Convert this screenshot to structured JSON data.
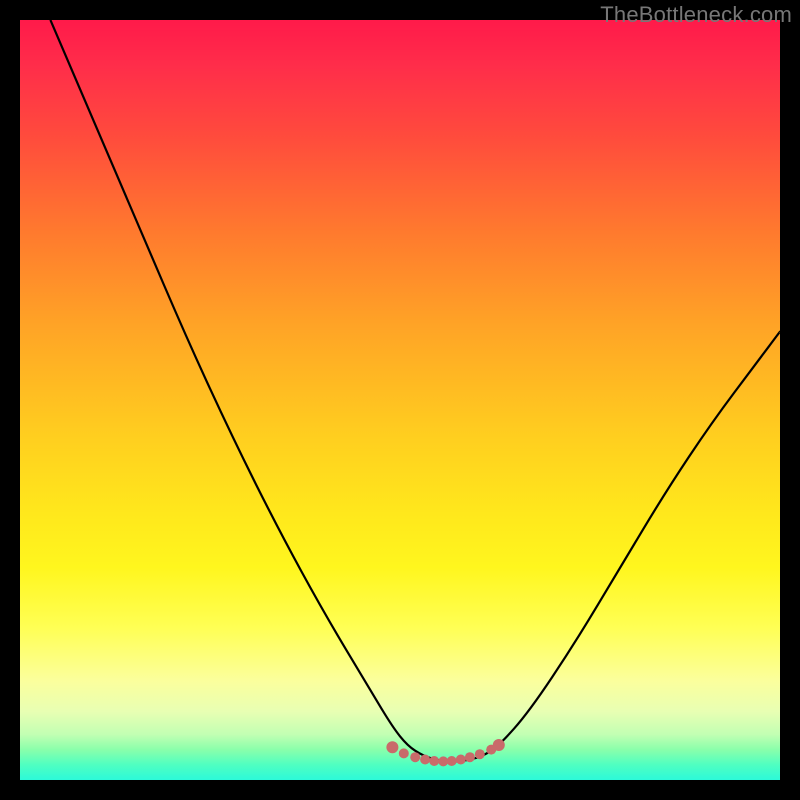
{
  "watermark": "TheBottleneck.com",
  "chart_data": {
    "type": "line",
    "title": "",
    "xlabel": "",
    "ylabel": "",
    "xlim": [
      0,
      100
    ],
    "ylim": [
      0,
      100
    ],
    "grid": false,
    "series": [
      {
        "name": "bottleneck-curve",
        "color": "#000000",
        "x": [
          4,
          10,
          16,
          22,
          28,
          34,
          40,
          46,
          49,
          51,
          53,
          55,
          57,
          59,
          61,
          63,
          67,
          73,
          79,
          85,
          91,
          97,
          100
        ],
        "y": [
          100,
          86,
          72,
          58,
          45,
          33,
          22,
          12,
          7,
          4.5,
          3.2,
          2.6,
          2.4,
          2.6,
          3.2,
          4.5,
          9,
          18,
          28,
          38,
          47,
          55,
          59
        ]
      },
      {
        "name": "valley-dots",
        "color": "#c96a6a",
        "style": "dots",
        "x": [
          49,
          50.5,
          52,
          53.3,
          54.5,
          55.7,
          56.8,
          58,
          59.2,
          60.5,
          62,
          63
        ],
        "y": [
          4.3,
          3.5,
          3.0,
          2.7,
          2.5,
          2.45,
          2.5,
          2.7,
          3.0,
          3.4,
          4.0,
          4.6
        ]
      }
    ]
  }
}
